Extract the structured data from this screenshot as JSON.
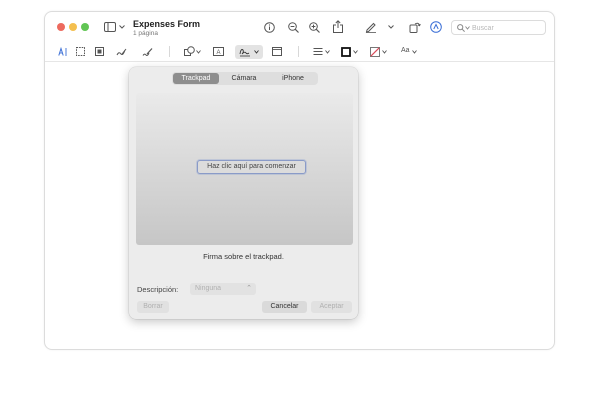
{
  "window": {
    "title": "Expenses Form",
    "subtitle": "1 página"
  },
  "search": {
    "placeholder": "Buscar"
  },
  "toolbar": {
    "text_style_label": "Aa"
  },
  "signature_popover": {
    "tabs": [
      {
        "label": "Trackpad",
        "active": true
      },
      {
        "label": "Cámara",
        "active": false
      },
      {
        "label": "iPhone",
        "active": false
      }
    ],
    "click_to_begin": "Haz clic aquí para comenzar",
    "hint": "Firma sobre el trackpad.",
    "description_label": "Descripción:",
    "description_value": "Ninguna",
    "clear_button": "Borrar",
    "cancel_button": "Cancelar",
    "accept_button": "Aceptar"
  },
  "colors": {
    "close": "#ed6a5e",
    "minimize": "#f4bf4f",
    "zoom": "#61c554",
    "active_tab": "#8e8e8e",
    "markup_accent": "#3b6fd6",
    "fill_color_icon": "#d94b5a"
  }
}
